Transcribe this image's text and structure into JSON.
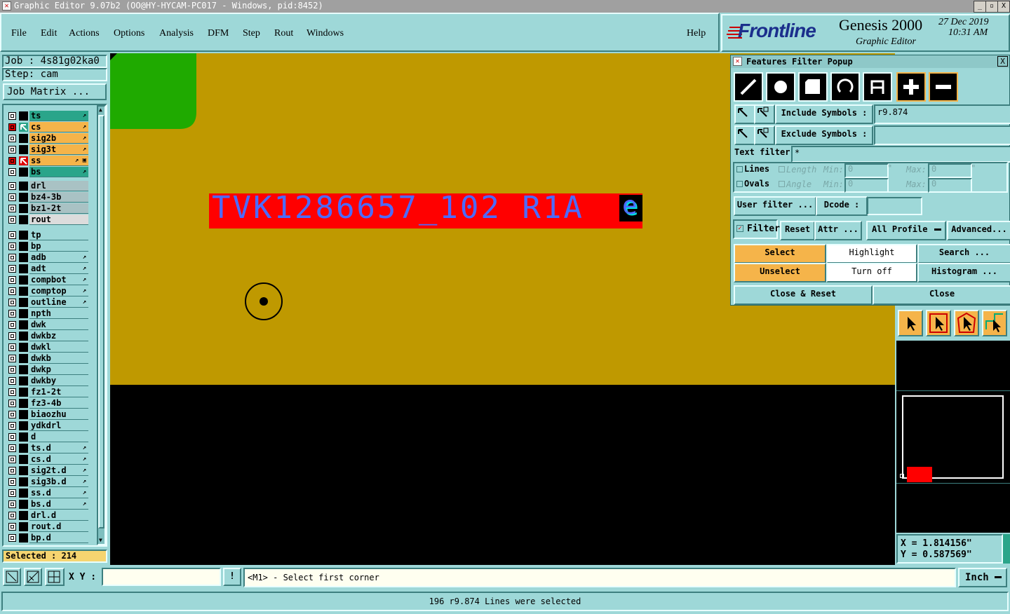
{
  "window": {
    "title": "Graphic Editor 9.07b2 (OO@HY-HYCAM-PC017 - Windows, pid:8452)",
    "minimize": "_",
    "maximize": "▫",
    "close": "X"
  },
  "menu": {
    "items": [
      "File",
      "Edit",
      "Actions",
      "Options",
      "Analysis",
      "DFM",
      "Step",
      "Rout",
      "Windows"
    ],
    "help": "Help"
  },
  "brand": {
    "logo": "Frontline",
    "product": "Genesis 2000",
    "subtitle": "Graphic Editor",
    "date": "27 Dec 2019",
    "time": "10:31 AM"
  },
  "job": {
    "job_label": "Job : 4s81g02ka0",
    "step_label": "Step: cam",
    "matrix_button": "Job Matrix ...",
    "selected": "Selected : 214"
  },
  "layers": {
    "group1": [
      {
        "name": "ts",
        "color": "#2aa58a",
        "flag": "↗"
      },
      {
        "name": "cs",
        "color": "#f5b44a",
        "flag": "↗",
        "work": true
      },
      {
        "name": "sig2b",
        "color": "#f5b44a",
        "flag": "↗"
      },
      {
        "name": "sig3t",
        "color": "#f5b44a",
        "flag": "↗"
      },
      {
        "name": "ss",
        "color": "#f5b44a",
        "flag": "↗ ▣",
        "active": true
      },
      {
        "name": "bs",
        "color": "#2aa58a",
        "flag": "↗"
      }
    ],
    "group2": [
      {
        "name": "drl",
        "color": "#a9c2c4"
      },
      {
        "name": "bz4-3b",
        "color": "#a9c2c4"
      },
      {
        "name": "bz1-2t",
        "color": "#a9c2c4"
      },
      {
        "name": "rout",
        "color": "#dcdcdc"
      }
    ],
    "group3": [
      {
        "name": "tp",
        "color": "#9ed8d8"
      },
      {
        "name": "bp",
        "color": "#9ed8d8"
      },
      {
        "name": "adb",
        "color": "#9ed8d8",
        "flag": "↗"
      },
      {
        "name": "adt",
        "color": "#9ed8d8",
        "flag": "↗"
      },
      {
        "name": "compbot",
        "color": "#9ed8d8",
        "flag": "↗"
      },
      {
        "name": "comptop",
        "color": "#9ed8d8",
        "flag": "↗"
      },
      {
        "name": "outline",
        "color": "#9ed8d8",
        "flag": "↗"
      },
      {
        "name": "npth",
        "color": "#9ed8d8"
      },
      {
        "name": "dwk",
        "color": "#9ed8d8"
      },
      {
        "name": "dwkbz",
        "color": "#9ed8d8"
      },
      {
        "name": "dwkl",
        "color": "#9ed8d8"
      },
      {
        "name": "dwkb",
        "color": "#9ed8d8"
      },
      {
        "name": "dwkp",
        "color": "#9ed8d8"
      },
      {
        "name": "dwkby",
        "color": "#9ed8d8"
      },
      {
        "name": "fz1-2t",
        "color": "#9ed8d8"
      },
      {
        "name": "fz3-4b",
        "color": "#9ed8d8"
      },
      {
        "name": "biaozhu",
        "color": "#9ed8d8"
      },
      {
        "name": "ydkdrl",
        "color": "#9ed8d8"
      },
      {
        "name": "d",
        "color": "#9ed8d8"
      },
      {
        "name": "ts.d",
        "color": "#9ed8d8",
        "flag": "↗"
      },
      {
        "name": "cs.d",
        "color": "#9ed8d8",
        "flag": "↗"
      },
      {
        "name": "sig2t.d",
        "color": "#9ed8d8",
        "flag": "↗"
      },
      {
        "name": "sig3b.d",
        "color": "#9ed8d8",
        "flag": "↗"
      },
      {
        "name": "ss.d",
        "color": "#9ed8d8",
        "flag": "↗"
      },
      {
        "name": "bs.d",
        "color": "#9ed8d8",
        "flag": "↗"
      },
      {
        "name": "drl.d",
        "color": "#9ed8d8"
      },
      {
        "name": "rout.d",
        "color": "#9ed8d8"
      },
      {
        "name": "bp.d",
        "color": "#9ed8d8"
      }
    ]
  },
  "canvas": {
    "board_text": "TVK1286657_102 R1A",
    "glyph": "e",
    "board_color": "#bf9900",
    "copper_color": "#1faa00",
    "highlight_color": "#ff0000",
    "text_color": "#4c6bff"
  },
  "popup": {
    "title": "Features Filter Popup",
    "close": "X",
    "feature_icons": [
      "line-icon",
      "pad-icon",
      "surface-icon",
      "arc-icon",
      "text-icon",
      "positive-icon",
      "negative-icon"
    ],
    "include_label": "Include Symbols :",
    "include_value": "r9.874",
    "exclude_label": "Exclude Symbols :",
    "exclude_value": "",
    "text_filter_label": "Text filter",
    "text_filter_value": "*",
    "lines_label": "Lines",
    "ovals_label": "Ovals",
    "length_label": "Length",
    "angle_label": "Angle",
    "min_label": "Min:",
    "max_label": "Max:",
    "length_min": "0",
    "length_max": "0",
    "angle_min": "0",
    "angle_max": "0",
    "length_unit": "\"",
    "user_filter": "User filter ...",
    "dcode_label": "Dcode :",
    "dcode_value": "",
    "filter_label": "Filter",
    "reset": "Reset",
    "attr": "Attr ...",
    "profile": "All Profile",
    "advanced": "Advanced...",
    "select": "Select",
    "highlight": "Highlight",
    "search": "Search ...",
    "unselect": "Unselect",
    "turn_off": "Turn off",
    "histogram": "Histogram ...",
    "close_reset": "Close & Reset",
    "close_btn": "Close"
  },
  "coords": {
    "x": "X = 1.814156\"",
    "y": "Y = 0.587569\""
  },
  "cmd": {
    "xy_label": "X Y :",
    "xy_value": "",
    "prompt": "<M1> - Select first corner",
    "units": "Inch",
    "info_icon": "!"
  },
  "status": {
    "message": "196 r9.874 Lines were selected"
  }
}
